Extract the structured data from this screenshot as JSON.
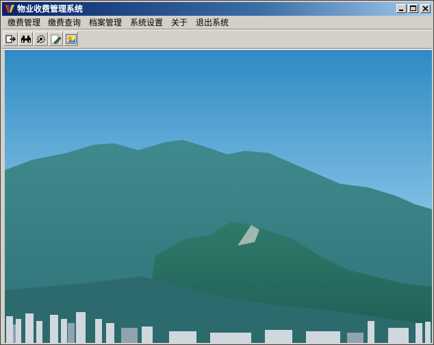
{
  "window": {
    "title": "物业收费管理系统"
  },
  "menu": {
    "items": [
      {
        "label": "缴费管理"
      },
      {
        "label": "缴费查询"
      },
      {
        "label": "档案管理"
      },
      {
        "label": "系统设置"
      },
      {
        "label": "关于"
      },
      {
        "label": "退出系统"
      }
    ]
  },
  "toolbar": {
    "icons": [
      "exit-icon",
      "binoculars-icon",
      "settings-icon",
      "edit-icon",
      "image-icon"
    ]
  },
  "colors": {
    "title_bar": "#0a246a",
    "chrome": "#d4d0c8"
  }
}
